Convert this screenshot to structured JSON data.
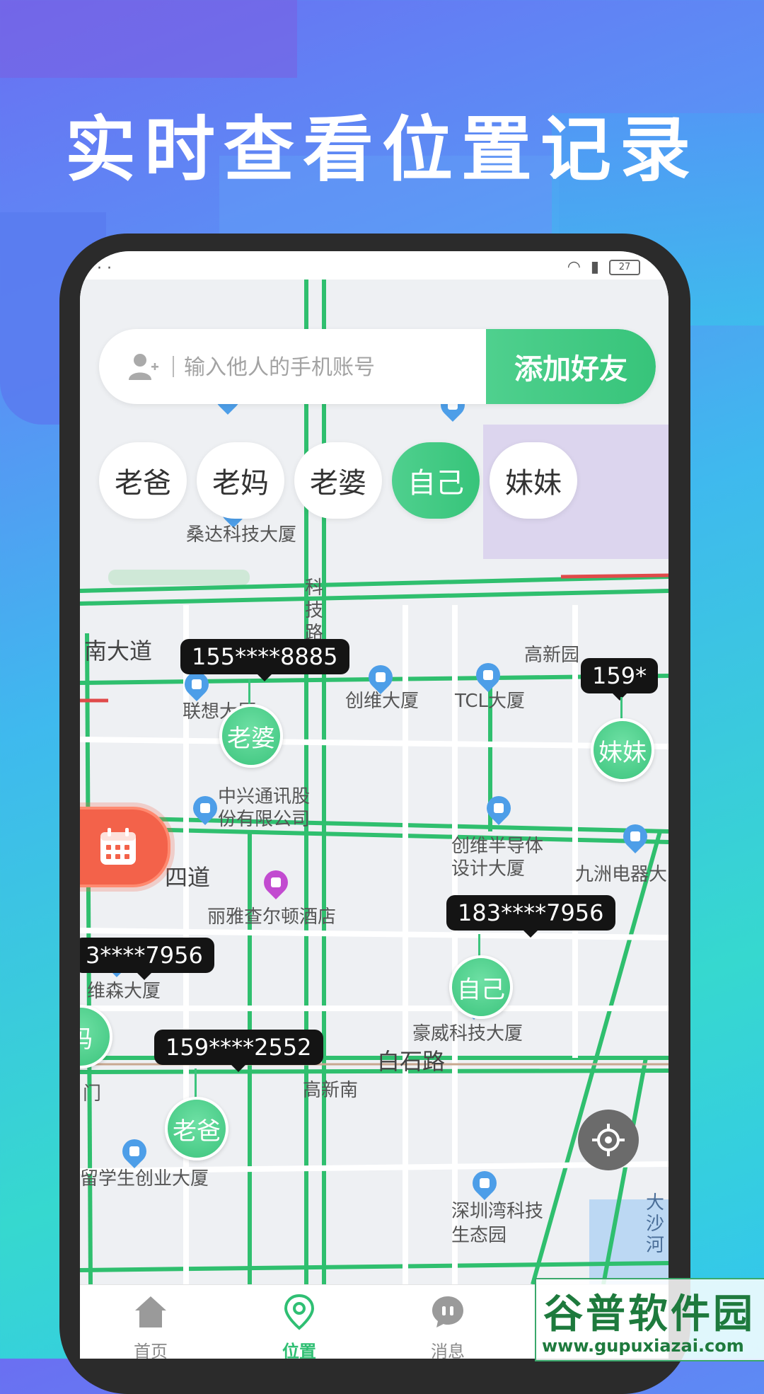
{
  "headline": "实时查看位置记录",
  "search": {
    "placeholder": "输入他人的手机账号",
    "add_button": "添加好友"
  },
  "chips": [
    {
      "label": "老爸",
      "active": false
    },
    {
      "label": "老妈",
      "active": false
    },
    {
      "label": "老婆",
      "active": false
    },
    {
      "label": "自己",
      "active": true
    },
    {
      "label": "妹妹",
      "active": false
    }
  ],
  "map": {
    "labels": {
      "sangda": "桑达科技大厦",
      "nandadao": "南大道",
      "keji_road": "科技路",
      "gaoxinyuan": "高新园",
      "lianxiang": "联想大厦",
      "chuangwei": "创维大厦",
      "tcl": "TCL大厦",
      "zte": "中兴通讯股份有限公司",
      "chuangwei_semi": "创维半导体设计大厦",
      "jiuzhou": "九洲电器大",
      "sidao": "四道",
      "liya": "丽雅查尔顿酒店",
      "weisen": "维森大厦",
      "haowei": "豪威科技大厦",
      "baishi": "白石路",
      "gaoxinnan": "高新南",
      "liuxuesheng": "留学生创业大厦",
      "shenzhenwan": "深圳湾科技生态园",
      "dashahe": "大沙河",
      "men": "门"
    },
    "markers": [
      {
        "phone": "155****8885",
        "name": "老婆"
      },
      {
        "phone": "159*",
        "name": "妹妹"
      },
      {
        "phone": "183****7956",
        "name": "自己"
      },
      {
        "phone": "3****7956",
        "name": "妈"
      },
      {
        "phone": "159****2552",
        "name": "老爸"
      }
    ]
  },
  "tabs": [
    {
      "label": "首页",
      "icon": "home-icon"
    },
    {
      "label": "位置",
      "icon": "location-icon"
    },
    {
      "label": "消息",
      "icon": "message-icon"
    }
  ],
  "watermark": {
    "title": "谷普软件园",
    "url": "www.gupuxiazai.com"
  },
  "colors": {
    "accent": "#3cc47d",
    "calendar": "#f3624a",
    "tag_bg": "#141414"
  }
}
